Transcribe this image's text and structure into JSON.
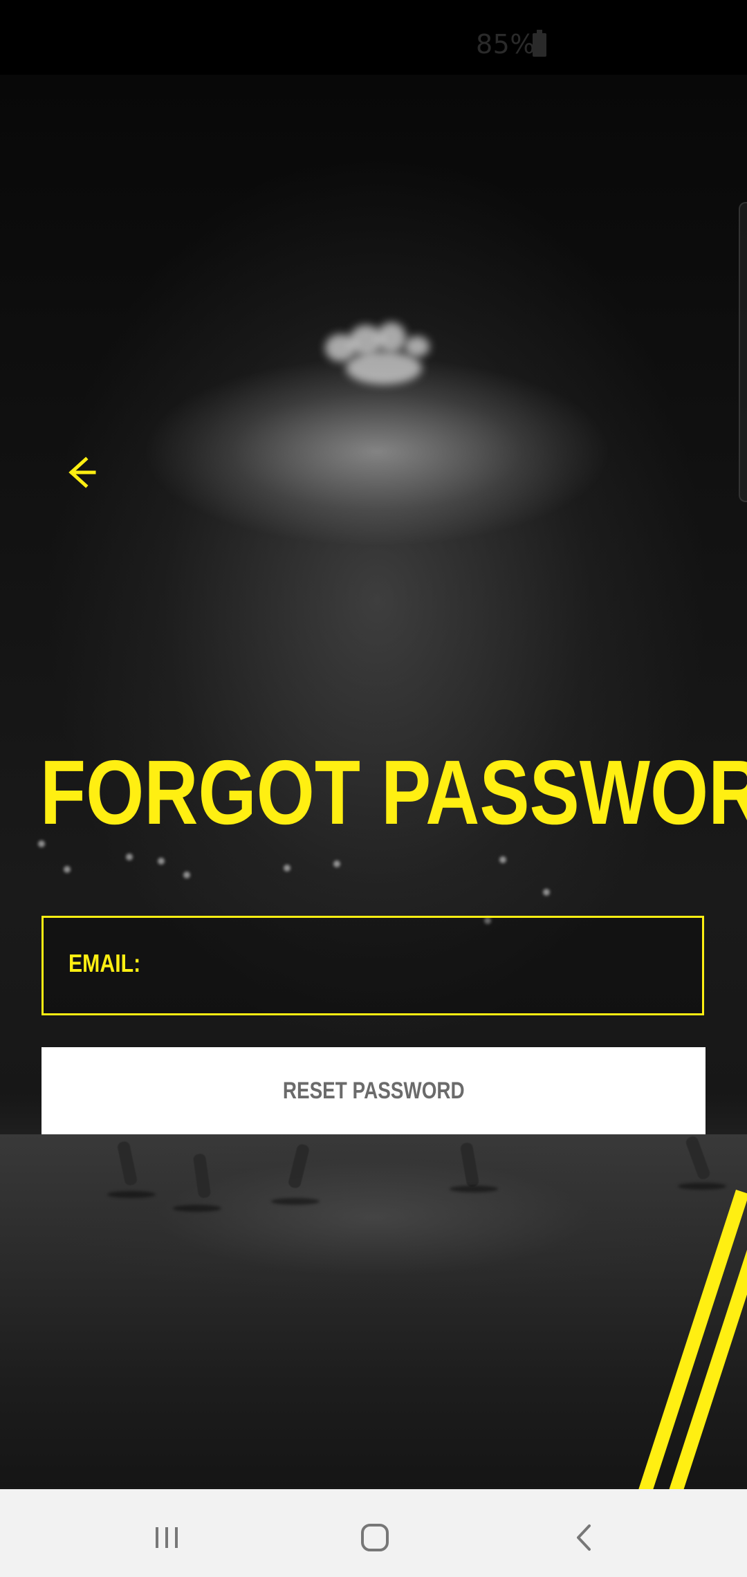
{
  "status_bar": {
    "battery": "85%",
    "battery_icon": "battery-icon"
  },
  "navigation": {
    "back_icon": "back-arrow-icon"
  },
  "page": {
    "title": "FORGOT PASSWORD"
  },
  "form": {
    "email_label": "EMAIL:",
    "email_value": "",
    "reset_button": "RESET PASSWORD"
  },
  "theme": {
    "accent": "#ffef12",
    "background": "#0b0b0b",
    "button_bg": "#ffffff",
    "button_text": "#6b6b6b"
  },
  "system_nav": {
    "recents_icon": "recent-apps-icon",
    "home_icon": "home-icon",
    "back_icon": "system-back-icon"
  }
}
